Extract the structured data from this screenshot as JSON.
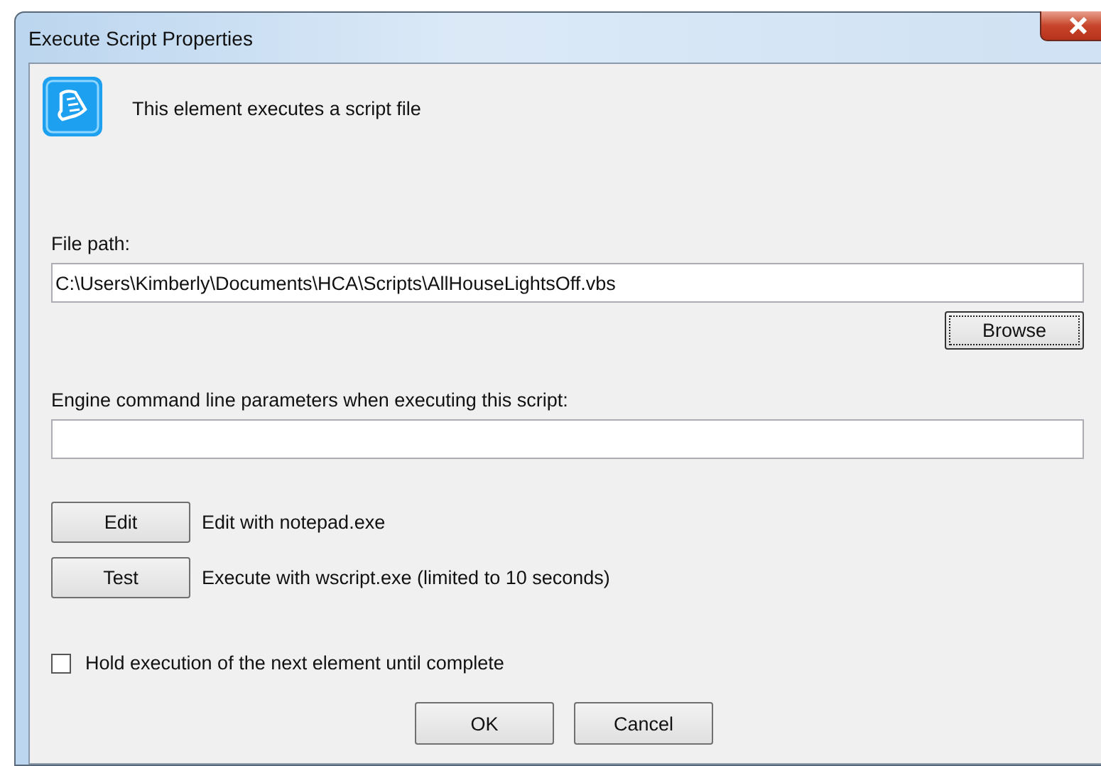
{
  "window": {
    "title": "Execute Script Properties"
  },
  "description": "This element executes a script file",
  "file_path": {
    "label": "File path:",
    "value": "C:\\Users\\Kimberly\\Documents\\HCA\\Scripts\\AllHouseLightsOff.vbs"
  },
  "browse_button": "Browse",
  "parameters": {
    "label": "Engine command line parameters when executing this script:"
  },
  "actions": [
    {
      "button": "Edit",
      "text": "Edit with notepad.exe"
    },
    {
      "button": "Test",
      "text": "Execute with wscript.exe (limited to 10 seconds)"
    }
  ],
  "hold_checkbox": {
    "label": "Hold execution of the next element until complete",
    "checked": false
  },
  "buttons": [
    "OK",
    "Cancel"
  ]
}
